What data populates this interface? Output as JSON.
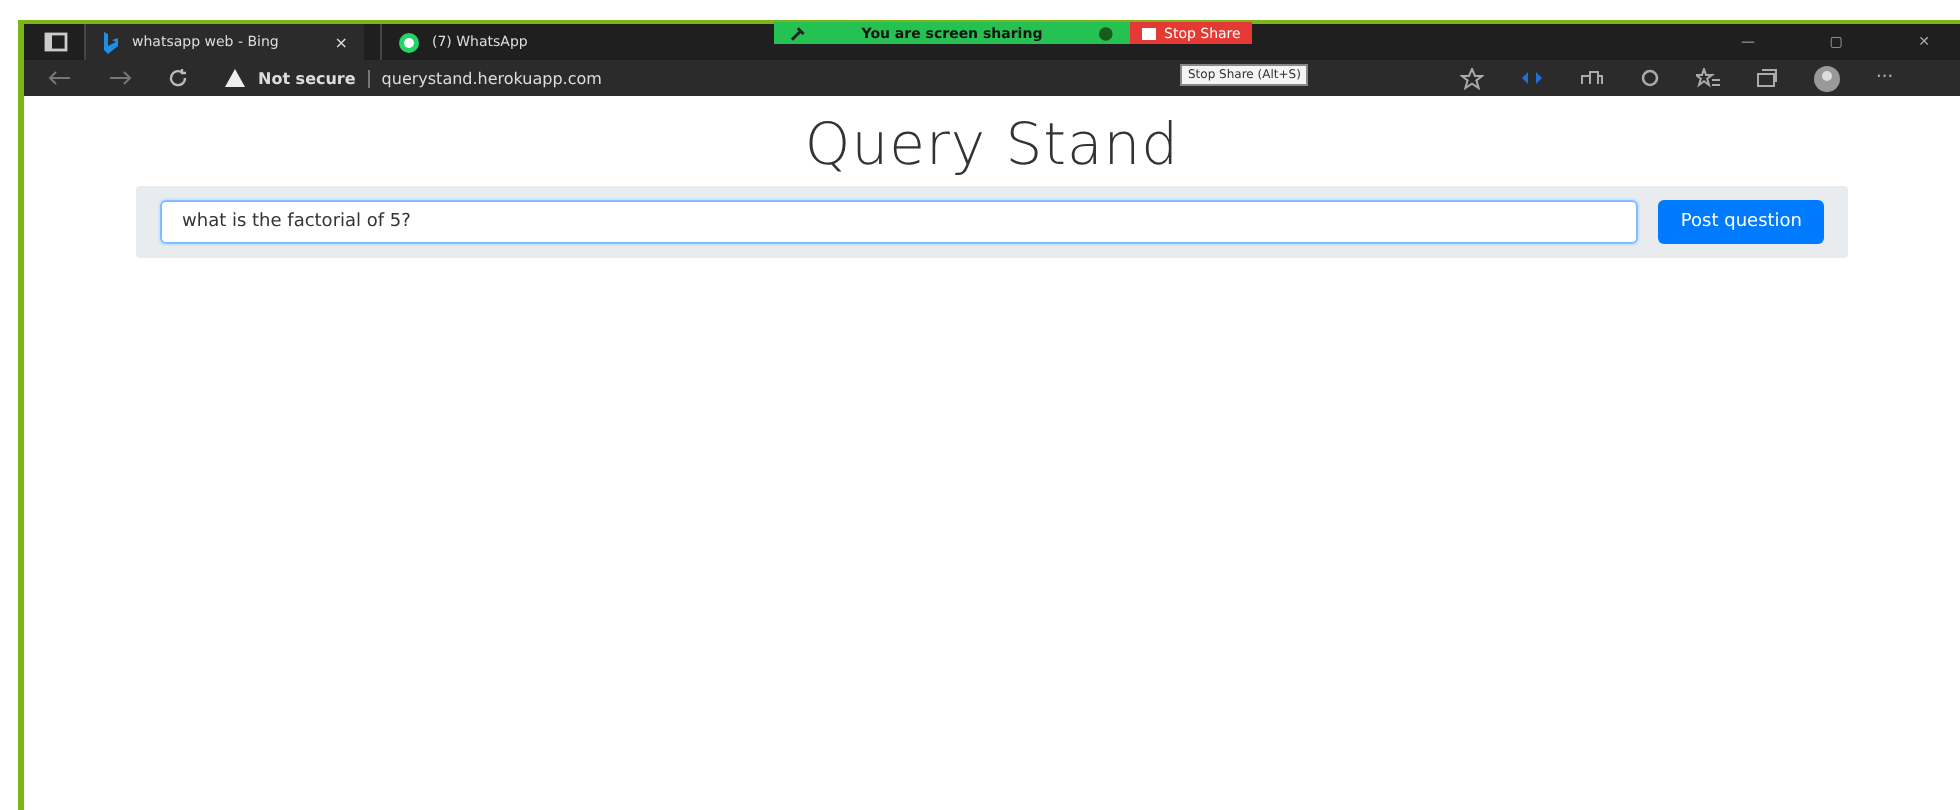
{
  "browser": {
    "tabs": [
      {
        "title": "whatsapp web - Bing",
        "selected": true,
        "close": "×"
      },
      {
        "title": "(7) WhatsApp",
        "selected": false
      }
    ],
    "window_controls": [
      "—",
      "▢",
      "✕"
    ],
    "security_label": "Not secure",
    "url": "querystand.herokuapp.com",
    "menu": "···"
  },
  "share_banner": {
    "message": "You are screen sharing",
    "stop_label": "Stop Share",
    "tooltip": "Stop Share (Alt+S)"
  },
  "page": {
    "title": "Query Stand",
    "question_value": "what is the factorial of 5?",
    "submit_label": "Post question"
  }
}
